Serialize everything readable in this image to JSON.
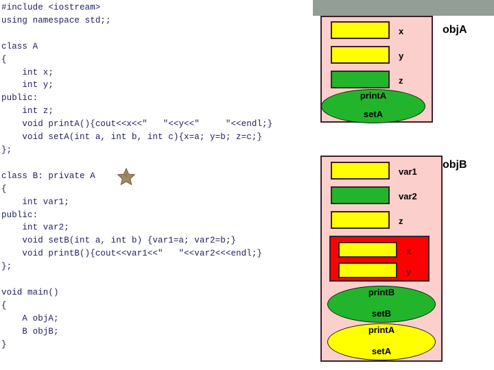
{
  "code": {
    "language": "cpp",
    "text": "#include <iostream>\nusing namespace std;;\n\nclass A\n{\n    int x;\n    int y;\npublic:\n    int z;\n    void printA(){cout<<x<<\"   \"<<y<<\"     \"<<endl;}\n    void setA(int a, int b, int c){x=a; y=b; z=c;}\n};\n\nclass B: private A\n{\n    int var1;\npublic:\n    int var2;\n    void setB(int a, int b) {var1=a; var2=b;}\n    void printB(){cout<<var1<<\"   \"<<var2<<<endl;}\n};\n\nvoid main()\n{\n    A objA;\n    B objB;\n}",
    "star_marker": "star-icon"
  },
  "diagrams": {
    "objA": {
      "caption": "objA",
      "members": [
        {
          "label": "x",
          "access": "private",
          "color": "#ffff00"
        },
        {
          "label": "y",
          "access": "private",
          "color": "#ffff00"
        },
        {
          "label": "z",
          "access": "public",
          "color": "#22b52b"
        }
      ],
      "methods": [
        {
          "line1": "printA",
          "line2": "setA",
          "access": "public",
          "color": "#22b52b"
        }
      ]
    },
    "objB": {
      "caption": "objB",
      "members": [
        {
          "label": "var1",
          "access": "private",
          "color": "#ffff00"
        },
        {
          "label": "var2",
          "access": "public",
          "color": "#22b52b"
        },
        {
          "label": "z",
          "access": "private",
          "color": "#ffff00"
        }
      ],
      "inherited_group": {
        "group_color": "#fe0000",
        "members": [
          {
            "label": "x",
            "access": "inaccessible",
            "color": "#ffff00"
          },
          {
            "label": "y",
            "access": "inaccessible",
            "color": "#ffff00"
          }
        ]
      },
      "methods": [
        {
          "line1": "printB",
          "line2": "setB",
          "access": "public",
          "color": "#22b52b"
        },
        {
          "line1": "printA",
          "line2": "setA",
          "access": "private",
          "color": "#ffff00"
        }
      ]
    }
  },
  "colors": {
    "top_bar": "#929e96",
    "object_background": "#fbcfcb",
    "object_border": "#3d1f28",
    "public_member": "#22b52b",
    "private_member": "#ffff00",
    "inaccessible_group": "#fe0000",
    "code_text": "#21215e",
    "star": "#a08a62"
  }
}
